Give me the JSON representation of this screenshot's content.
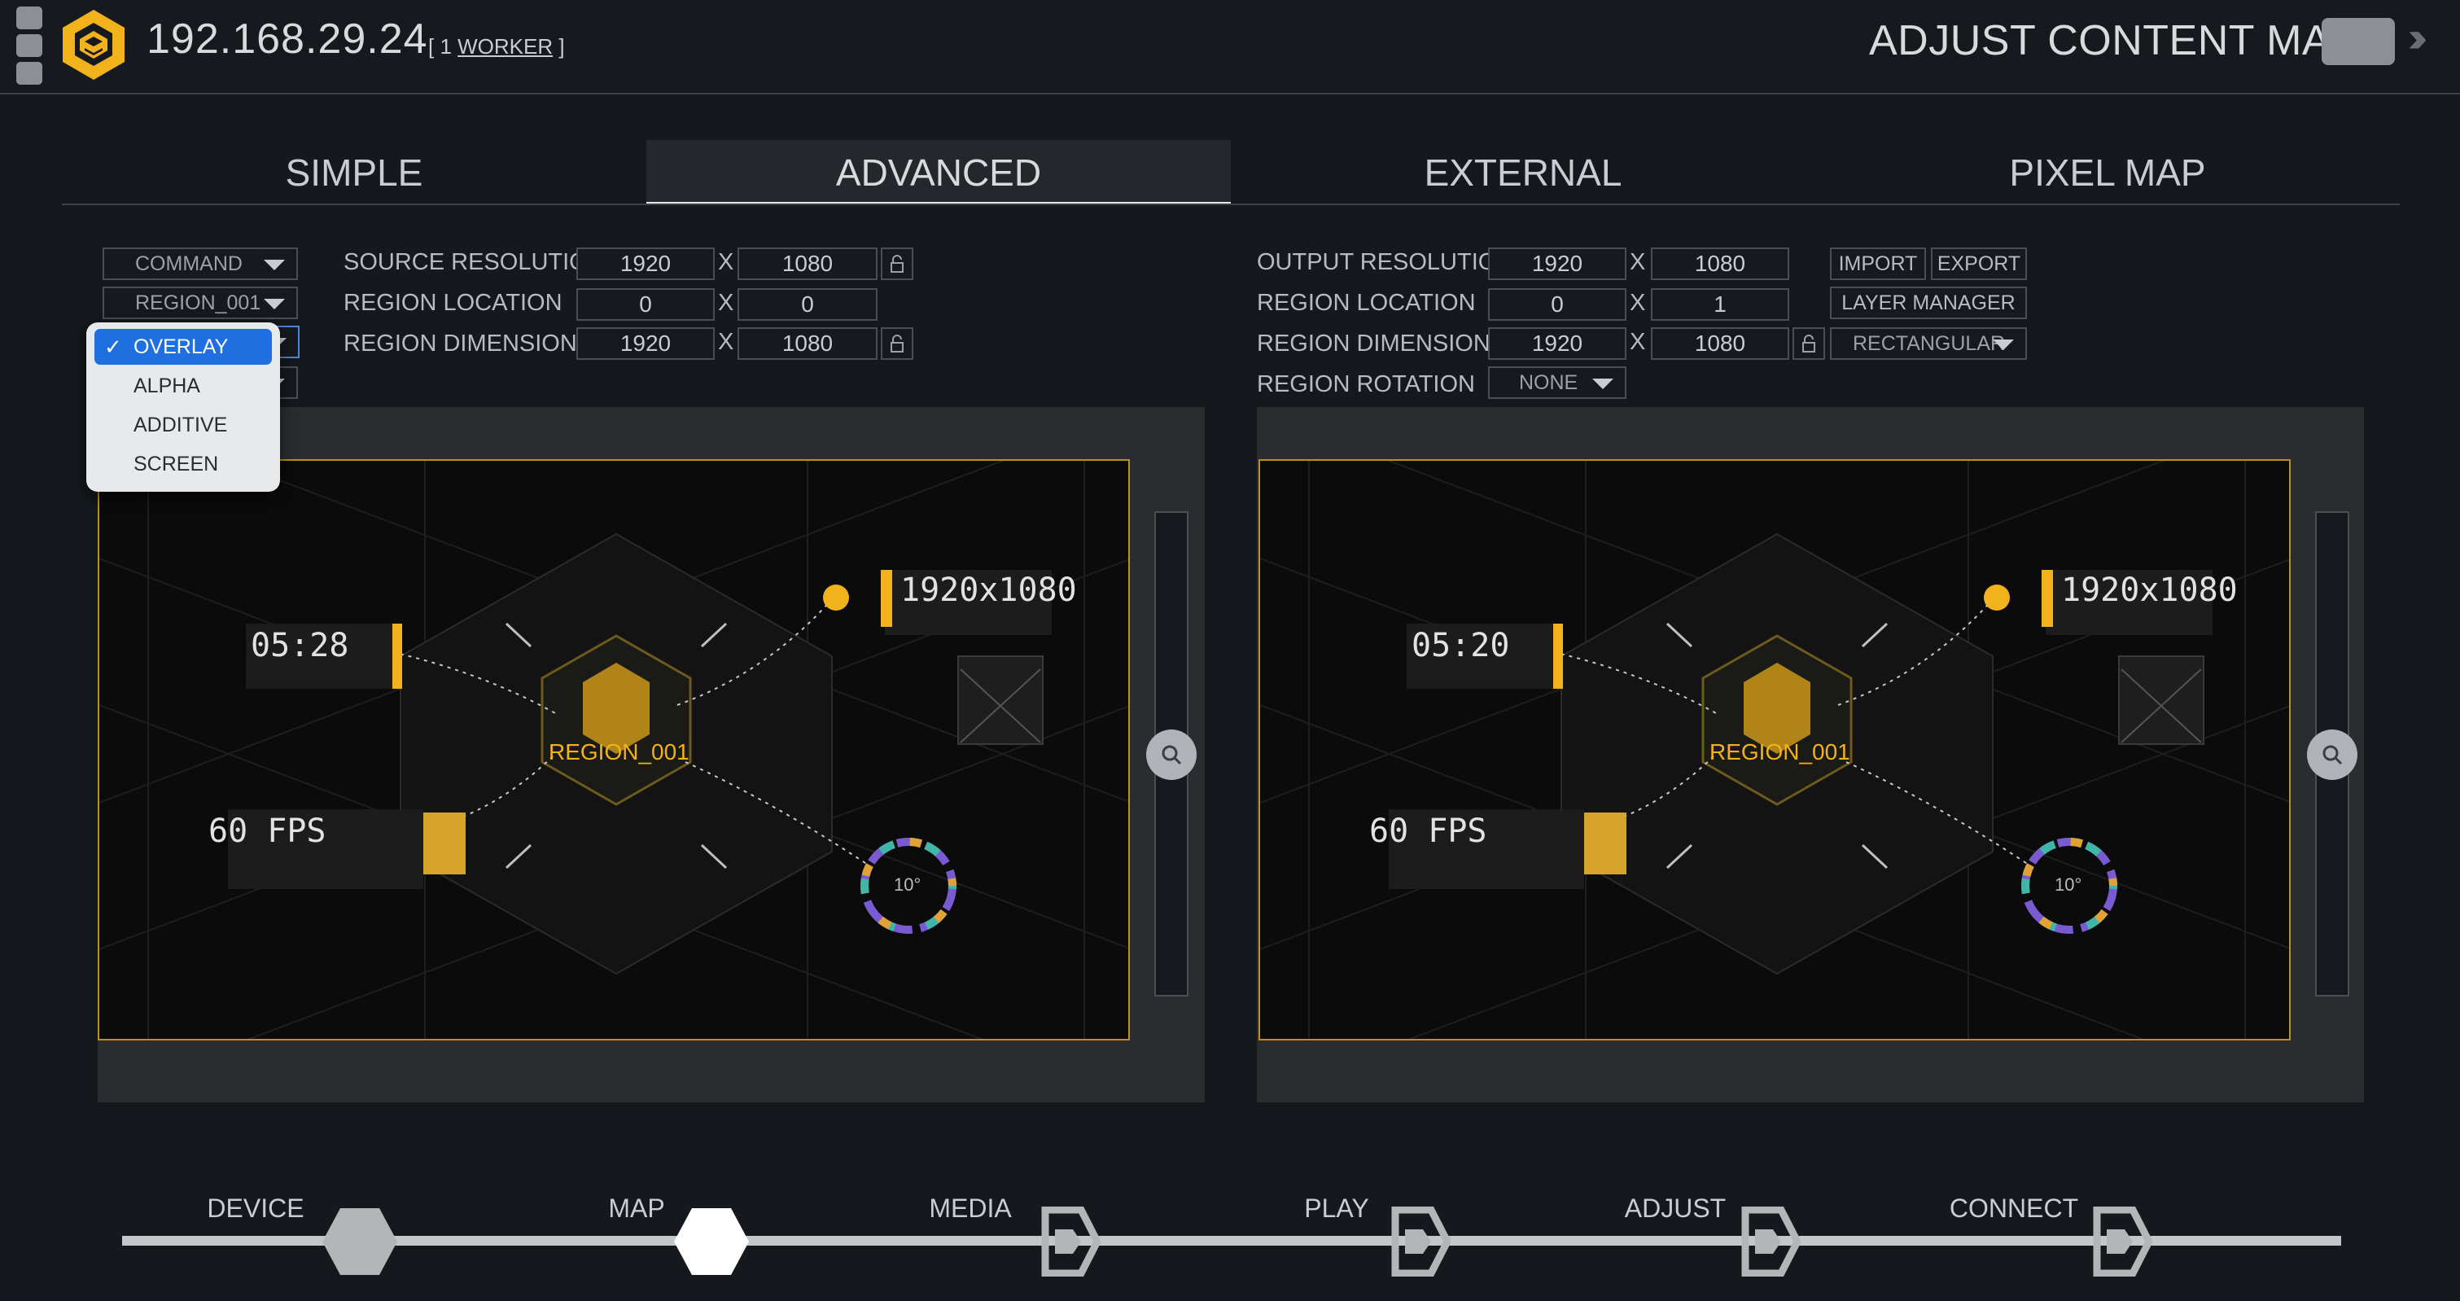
{
  "header": {
    "ip": "192.168.29.24",
    "workers_prefix": "[ 1 ",
    "workers_link": "WORKER",
    "workers_suffix": " ]",
    "page_title": "ADJUST CONTENT MAP"
  },
  "tabs": [
    {
      "label": "SIMPLE",
      "active": false
    },
    {
      "label": "ADVANCED",
      "active": true
    },
    {
      "label": "EXTERNAL",
      "active": false
    },
    {
      "label": "PIXEL MAP",
      "active": false
    }
  ],
  "left": {
    "command_select": "COMMAND",
    "region_select": "REGION_001",
    "source_resolution_label": "SOURCE RESOLUTION",
    "source_w": "1920",
    "source_h": "1080",
    "region_location_label": "REGION LOCATION",
    "loc_x": "0",
    "loc_y": "0",
    "region_dimensions_label": "REGION DIMENSIONS",
    "dim_w": "1920",
    "dim_h": "1080",
    "x_sep": "X"
  },
  "blend_menu": {
    "options": [
      "OVERLAY",
      "ALPHA",
      "ADDITIVE",
      "SCREEN"
    ],
    "selected": "OVERLAY",
    "check": "✓"
  },
  "right": {
    "output_resolution_label": "OUTPUT RESOLUTION",
    "out_w": "1920",
    "out_h": "1080",
    "import_label": "IMPORT",
    "export_label": "EXPORT",
    "region_location_label": "REGION LOCATION",
    "loc_x": "0",
    "loc_y": "1",
    "layer_manager_label": "LAYER MANAGER",
    "region_dimensions_label": "REGION DIMENSIONS",
    "dim_w": "1920",
    "dim_h": "1080",
    "shape_select": "RECTANGULAR",
    "region_rotation_label": "REGION ROTATION",
    "rotation_select": "NONE",
    "x_sep": "X"
  },
  "preview_left": {
    "region_label": "REGION_001",
    "timer": "05:28",
    "fps": "60 FPS",
    "resolution": "1920x1080",
    "dial": "10°"
  },
  "preview_right": {
    "region_label": "REGION_001",
    "timer": "05:20",
    "fps": "60 FPS",
    "resolution": "1920x1080",
    "dial": "10°"
  },
  "steps": [
    {
      "label": "DEVICE",
      "state": "done"
    },
    {
      "label": "MAP",
      "state": "current"
    },
    {
      "label": "MEDIA",
      "state": "todo"
    },
    {
      "label": "PLAY",
      "state": "todo"
    },
    {
      "label": "ADJUST",
      "state": "todo"
    },
    {
      "label": "CONNECT",
      "state": "todo"
    }
  ],
  "colors": {
    "accent": "#f2b21b",
    "background": "#15181c",
    "panel": "#2a2c2f",
    "selection_blue": "#1f6fe0",
    "preview_border": "#b8911e"
  }
}
